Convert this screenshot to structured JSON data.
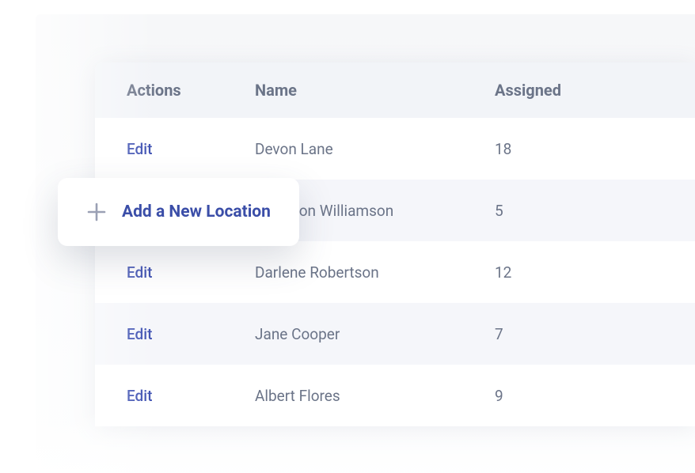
{
  "table": {
    "headers": {
      "actions": "Actions",
      "name": "Name",
      "assigned": "Assigned"
    },
    "edit_label": "Edit",
    "rows": [
      {
        "name": "Devon Lane",
        "assigned": "18"
      },
      {
        "name": "Cameron Williamson",
        "assigned": "5"
      },
      {
        "name": "Darlene Robertson",
        "assigned": "12"
      },
      {
        "name": "Jane Cooper",
        "assigned": "7"
      },
      {
        "name": "Albert Flores",
        "assigned": "9"
      }
    ]
  },
  "floating_button": {
    "label": "Add a New Location"
  }
}
